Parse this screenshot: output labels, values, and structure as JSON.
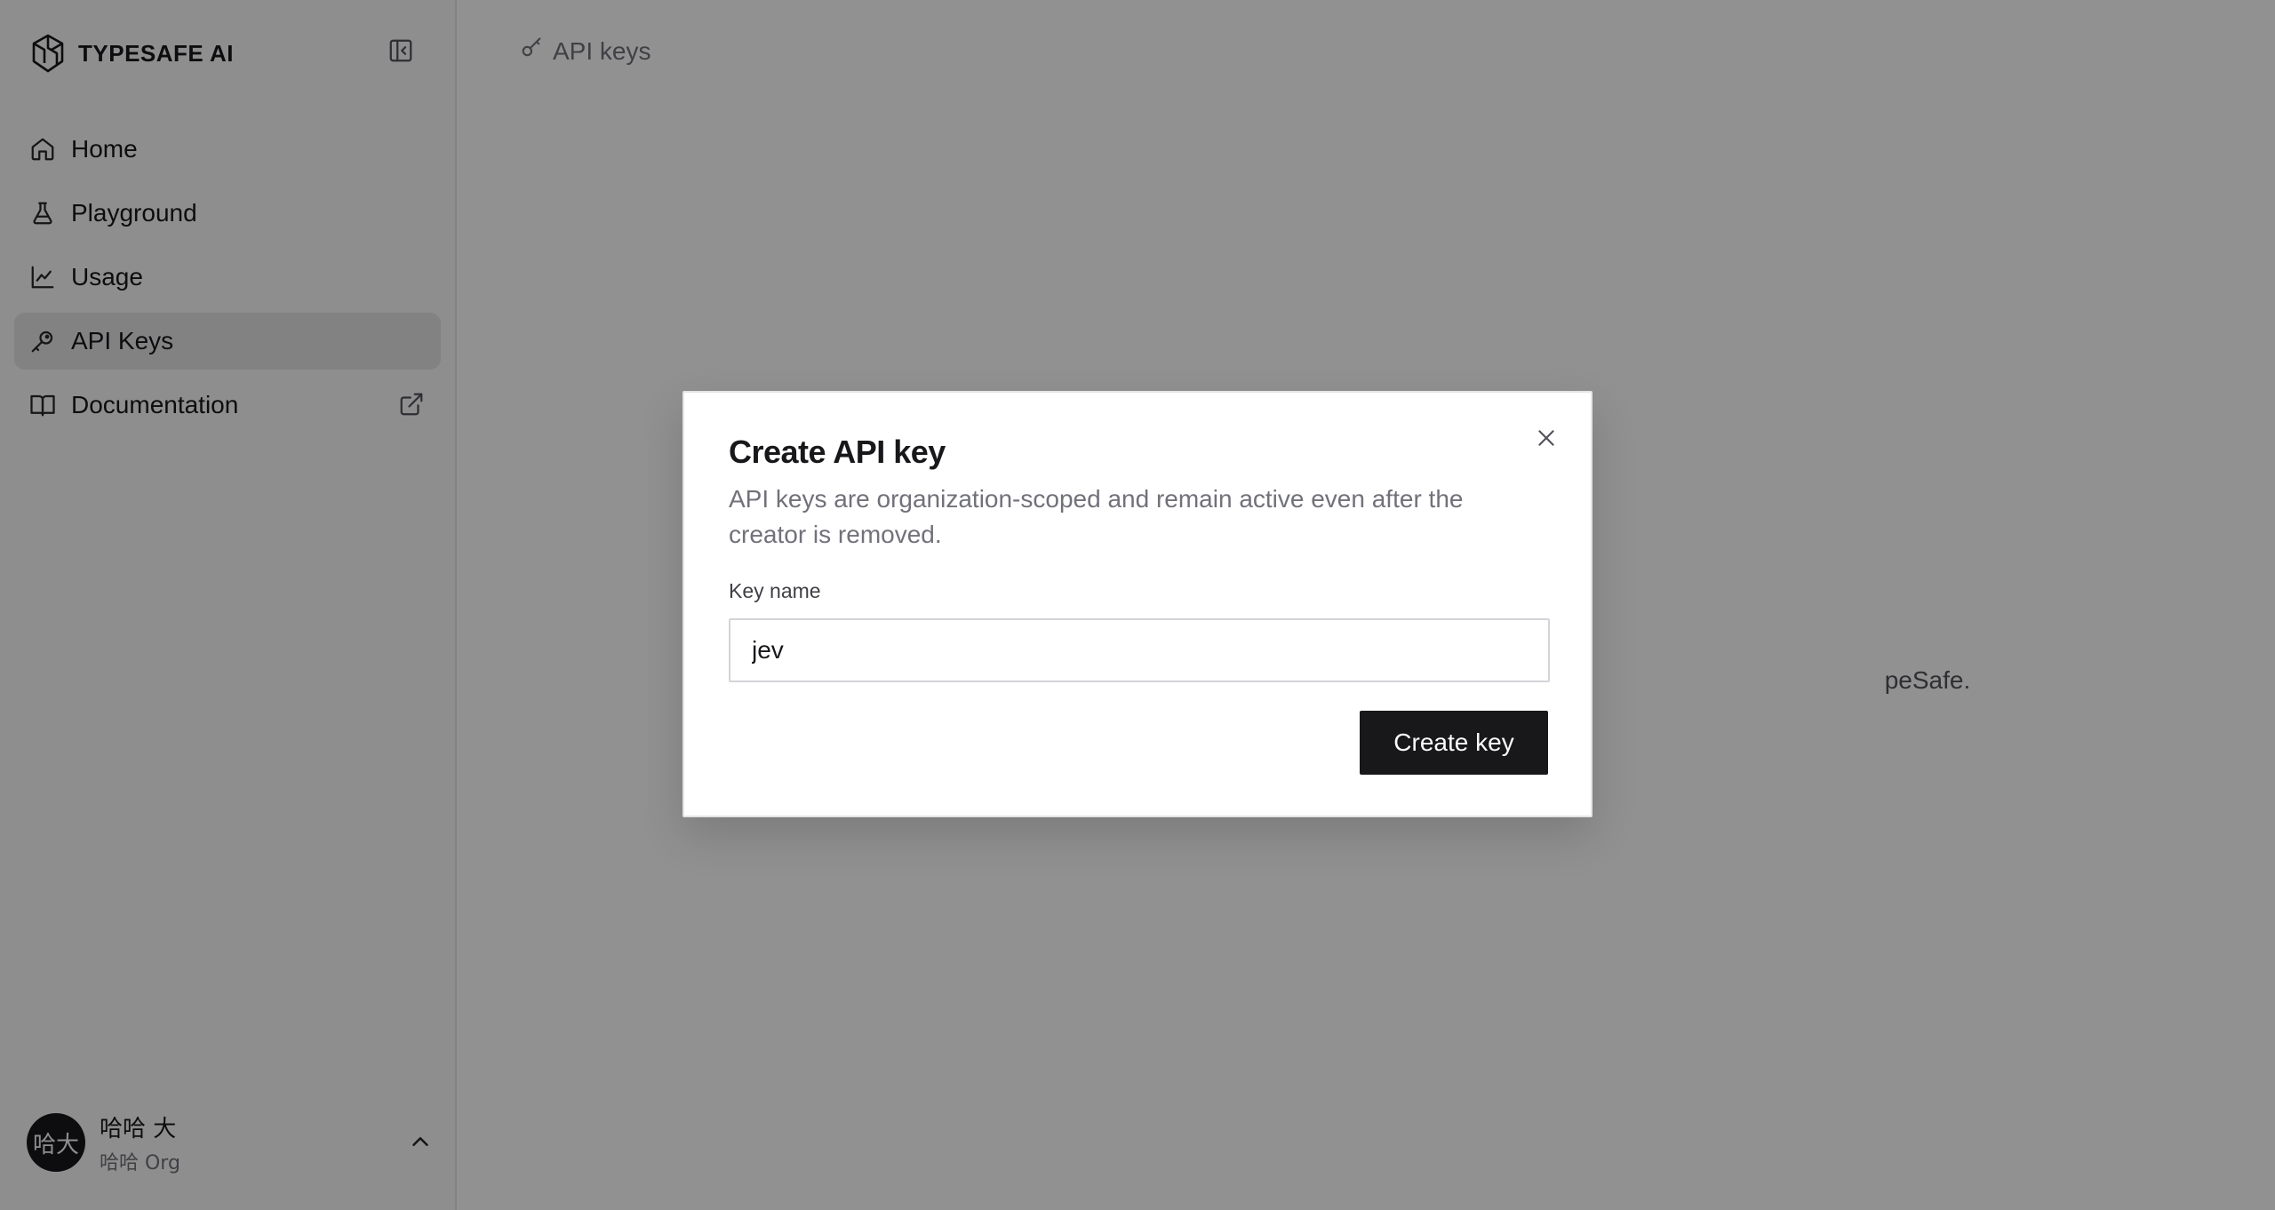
{
  "brand": {
    "name": "TYPESAFE AI",
    "logo_icon": "typesafe-logo-icon"
  },
  "sidebar": {
    "collapse_icon": "panel-left-icon",
    "items": [
      {
        "label": "Home",
        "icon": "home-icon",
        "active": false
      },
      {
        "label": "Playground",
        "icon": "flask-icon",
        "active": false
      },
      {
        "label": "Usage",
        "icon": "chart-line-icon",
        "active": false
      },
      {
        "label": "API Keys",
        "icon": "key-icon",
        "active": true
      },
      {
        "label": "Documentation",
        "icon": "book-icon",
        "active": false,
        "external_icon": "external-link-icon"
      }
    ],
    "user": {
      "avatar_text": "哈大",
      "name": "哈哈 大",
      "org": "哈哈 Org",
      "chevron_icon": "chevron-up-icon"
    }
  },
  "main": {
    "breadcrumb": {
      "icon": "key-icon",
      "label": "API keys"
    },
    "background_message": "peSafe."
  },
  "modal": {
    "title": "Create API key",
    "description": "API keys are organization-scoped and remain active even after the creator is removed.",
    "field_label": "Key name",
    "field_value": "jev",
    "submit_label": "Create key",
    "close_icon": "close-icon"
  },
  "colors": {
    "primary": "#18181b",
    "muted_text": "#71717a",
    "sidebar_bg": "#fafafa",
    "active_item_bg": "#e4e4e7",
    "overlay": "rgba(0,0,0,0.43)"
  }
}
